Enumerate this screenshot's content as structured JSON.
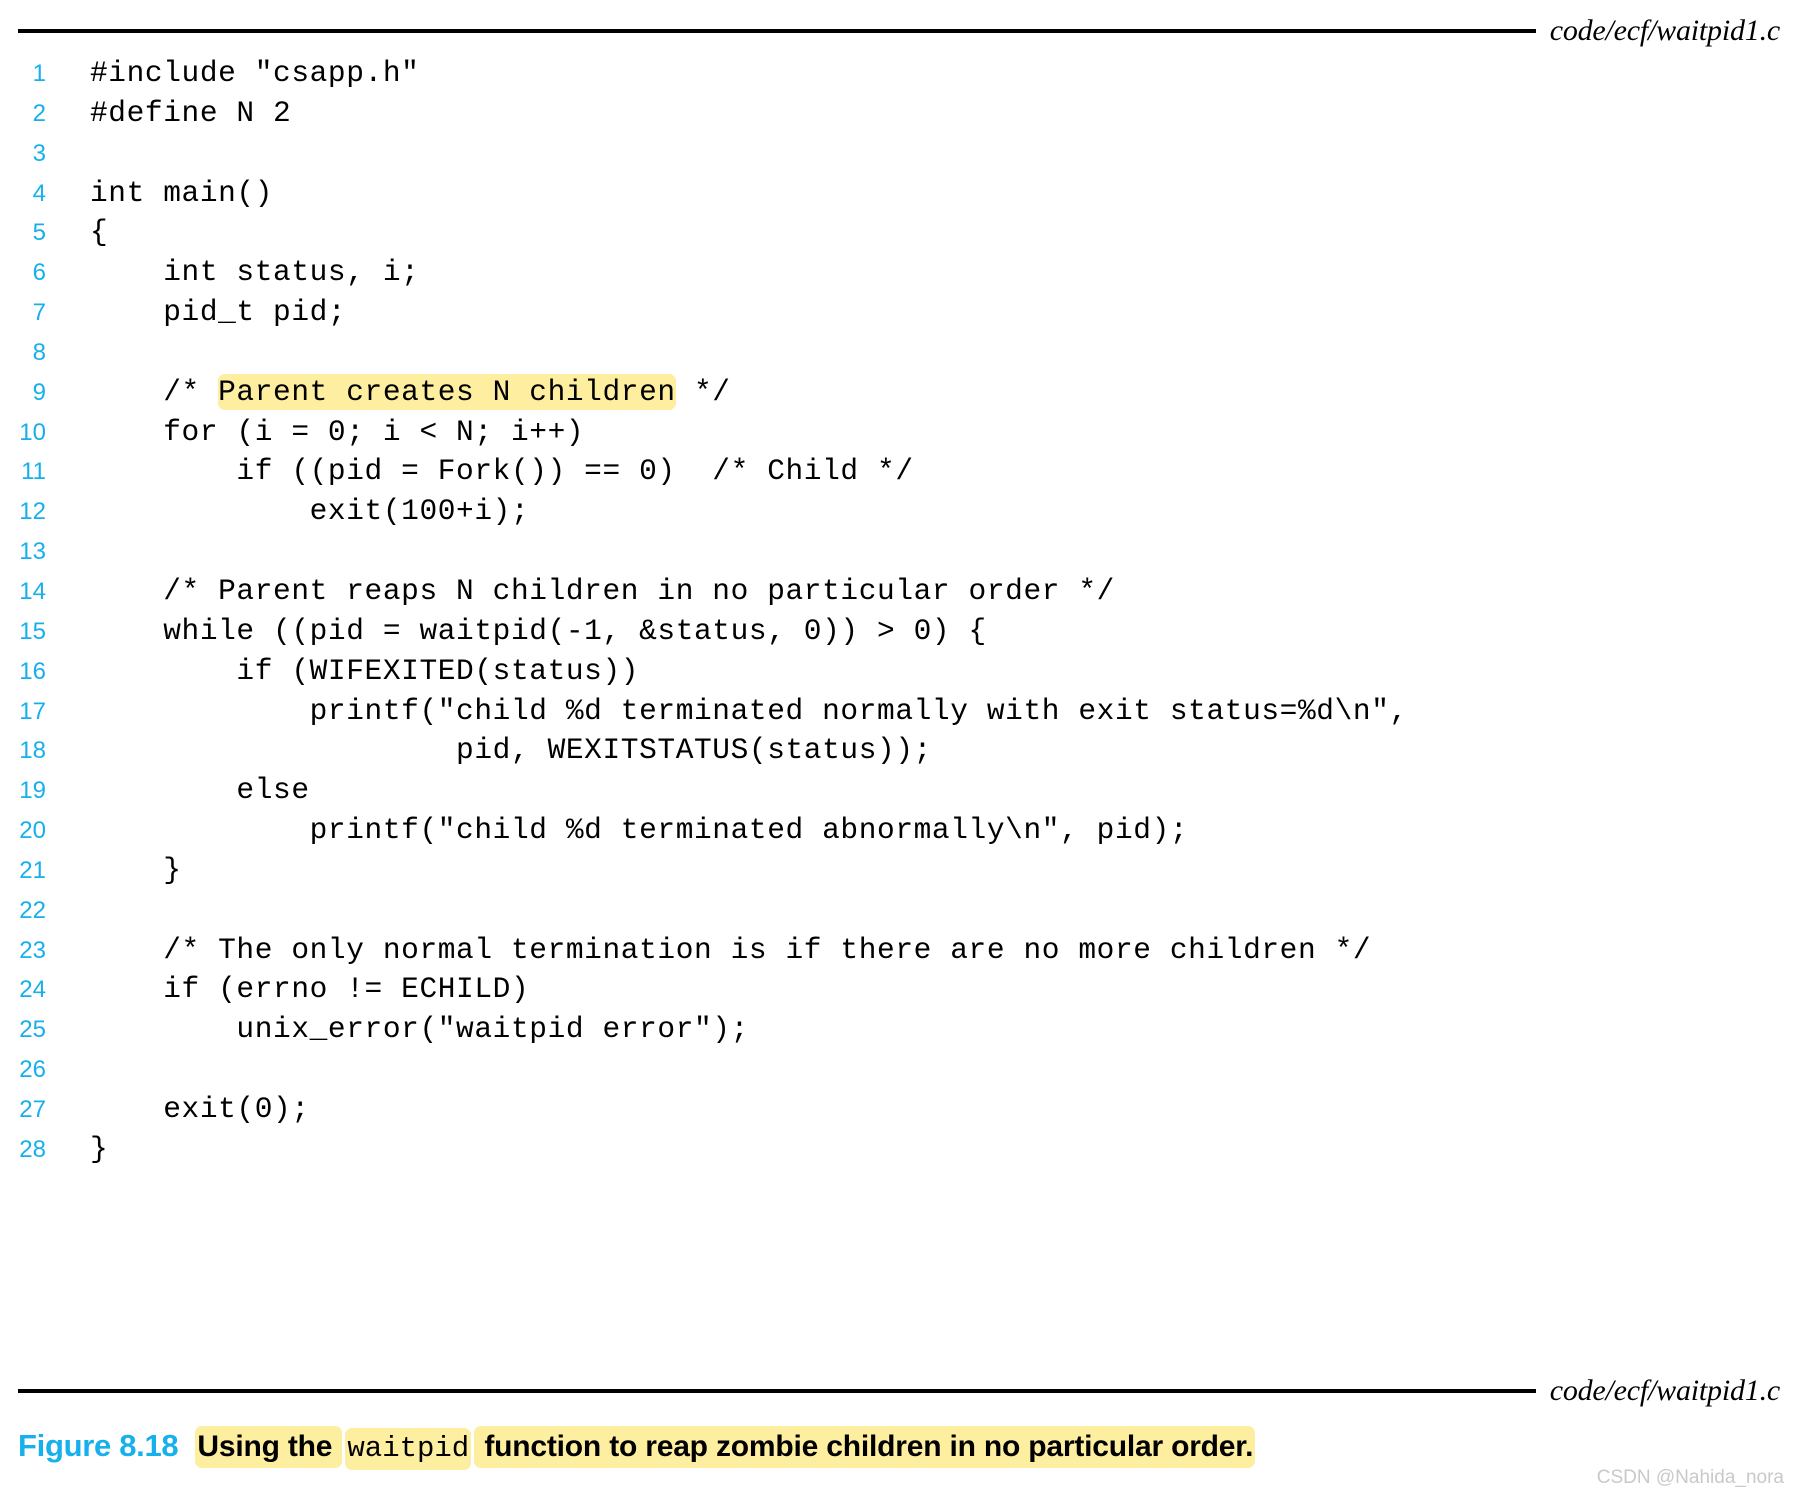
{
  "figure": {
    "top_filename": "code/ecf/waitpid1.c",
    "bottom_filename": "code/ecf/waitpid1.c",
    "caption_number": "Figure 8.18",
    "caption_segments": [
      {
        "text": "Using the ",
        "mono": false
      },
      {
        "text": "waitpid",
        "mono": true
      },
      {
        "text": " function to reap zombie children in no particular order.",
        "mono": false
      }
    ],
    "watermark": "CSDN @Nahida_nora"
  },
  "colors": {
    "line_number": "#16b0ec",
    "figure_number": "#16b0ec",
    "highlight": "#fdeea0",
    "code_text": "#000000",
    "rule": "#000000",
    "watermark": "#c9c9c9"
  },
  "code": {
    "language": "c",
    "lines": [
      {
        "n": "1",
        "pre": "#include \"csapp.h\"",
        "hl": "",
        "post": ""
      },
      {
        "n": "2",
        "pre": "#define N 2",
        "hl": "",
        "post": ""
      },
      {
        "n": "3",
        "pre": "",
        "hl": "",
        "post": ""
      },
      {
        "n": "4",
        "pre": "int main()",
        "hl": "",
        "post": ""
      },
      {
        "n": "5",
        "pre": "{",
        "hl": "",
        "post": ""
      },
      {
        "n": "6",
        "pre": "    int status, i;",
        "hl": "",
        "post": ""
      },
      {
        "n": "7",
        "pre": "    pid_t pid;",
        "hl": "",
        "post": ""
      },
      {
        "n": "8",
        "pre": "",
        "hl": "",
        "post": ""
      },
      {
        "n": "9",
        "pre": "    /* ",
        "hl": "Parent creates N children",
        "post": " */"
      },
      {
        "n": "10",
        "pre": "    for (i = 0; i < N; i++)",
        "hl": "",
        "post": ""
      },
      {
        "n": "11",
        "pre": "        if ((pid = Fork()) == 0)  /* Child */",
        "hl": "",
        "post": ""
      },
      {
        "n": "12",
        "pre": "            exit(100+i);",
        "hl": "",
        "post": ""
      },
      {
        "n": "13",
        "pre": "",
        "hl": "",
        "post": ""
      },
      {
        "n": "14",
        "pre": "    /* Parent reaps N children in no particular order */",
        "hl": "",
        "post": ""
      },
      {
        "n": "15",
        "pre": "    while ((pid = waitpid(-1, &status, 0)) > 0) {",
        "hl": "",
        "post": ""
      },
      {
        "n": "16",
        "pre": "        if (WIFEXITED(status))",
        "hl": "",
        "post": ""
      },
      {
        "n": "17",
        "pre": "            printf(\"child %d terminated normally with exit status=%d\\n\",",
        "hl": "",
        "post": ""
      },
      {
        "n": "18",
        "pre": "                    pid, WEXITSTATUS(status));",
        "hl": "",
        "post": ""
      },
      {
        "n": "19",
        "pre": "        else",
        "hl": "",
        "post": ""
      },
      {
        "n": "20",
        "pre": "            printf(\"child %d terminated abnormally\\n\", pid);",
        "hl": "",
        "post": ""
      },
      {
        "n": "21",
        "pre": "    }",
        "hl": "",
        "post": ""
      },
      {
        "n": "22",
        "pre": "",
        "hl": "",
        "post": ""
      },
      {
        "n": "23",
        "pre": "    /* The only normal termination is if there are no more children */",
        "hl": "",
        "post": ""
      },
      {
        "n": "24",
        "pre": "    if (errno != ECHILD)",
        "hl": "",
        "post": ""
      },
      {
        "n": "25",
        "pre": "        unix_error(\"waitpid error\");",
        "hl": "",
        "post": ""
      },
      {
        "n": "26",
        "pre": "",
        "hl": "",
        "post": ""
      },
      {
        "n": "27",
        "pre": "    exit(0);",
        "hl": "",
        "post": ""
      },
      {
        "n": "28",
        "pre": "}",
        "hl": "",
        "post": ""
      }
    ]
  }
}
